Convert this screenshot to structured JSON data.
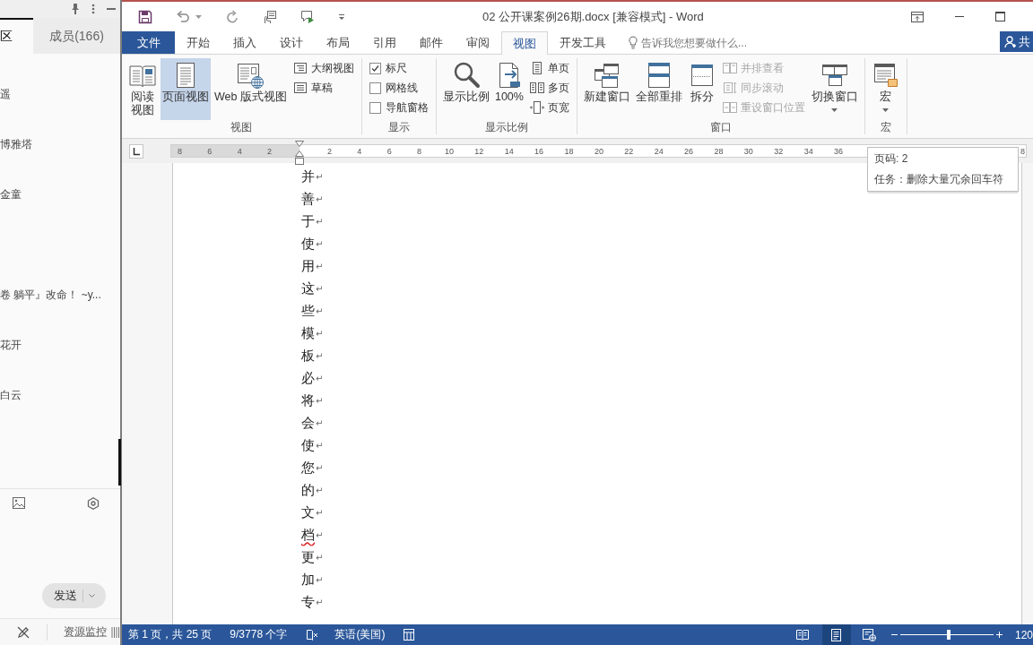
{
  "chat_panel": {
    "tabs": [
      {
        "label": "区",
        "selected": true
      },
      {
        "label": "成员(166)",
        "selected": false
      }
    ],
    "members": [
      {
        "name": "遥"
      },
      {
        "name": "博雅塔"
      },
      {
        "name": "金童"
      },
      {
        "name": "卷 躺平』改命！ ~y..."
      },
      {
        "name": "花开"
      },
      {
        "name": "白云"
      }
    ],
    "send_button": "发送",
    "resource_monitor": "资源监控"
  },
  "word": {
    "title": "02 公开课案例26期.docx [兼容模式] - Word",
    "tabs": [
      {
        "label": "文件",
        "kind": "file",
        "selected": false
      },
      {
        "label": "开始",
        "kind": "tab",
        "selected": false
      },
      {
        "label": "插入",
        "kind": "tab",
        "selected": false
      },
      {
        "label": "设计",
        "kind": "tab",
        "selected": false
      },
      {
        "label": "布局",
        "kind": "tab",
        "selected": false
      },
      {
        "label": "引用",
        "kind": "tab",
        "selected": false
      },
      {
        "label": "邮件",
        "kind": "tab",
        "selected": false
      },
      {
        "label": "审阅",
        "kind": "tab",
        "selected": false
      },
      {
        "label": "视图",
        "kind": "tab",
        "selected": true
      },
      {
        "label": "开发工具",
        "kind": "tab",
        "selected": false
      }
    ],
    "tell_me": {
      "placeholder": "告诉我您想要做什么..."
    },
    "share_button": "共",
    "ribbon_groups": [
      {
        "label": "视图",
        "items": [
          {
            "kind": "large",
            "label": "阅读视图",
            "selected": false
          },
          {
            "kind": "large",
            "label": "页面视图",
            "selected": true
          },
          {
            "kind": "large",
            "label": "Web 版式视图",
            "selected": false
          },
          {
            "kind": "stack",
            "items": [
              {
                "label": "大纲视图",
                "disabled": false
              },
              {
                "label": "草稿",
                "disabled": false
              }
            ]
          }
        ]
      },
      {
        "label": "显示",
        "items": [
          {
            "kind": "checks",
            "items": [
              {
                "label": "标尺",
                "checked": true
              },
              {
                "label": "网格线",
                "checked": false
              },
              {
                "label": "导航窗格",
                "checked": false
              }
            ]
          }
        ]
      },
      {
        "label": "显示比例",
        "items": [
          {
            "kind": "large",
            "label": "显示比例"
          },
          {
            "kind": "large",
            "label": "100%"
          },
          {
            "kind": "stack",
            "items": [
              {
                "label": "单页",
                "disabled": false
              },
              {
                "label": "多页",
                "disabled": false
              },
              {
                "label": "页宽",
                "disabled": false
              }
            ]
          }
        ]
      },
      {
        "label": "窗口",
        "items": [
          {
            "kind": "large",
            "label": "新建窗口"
          },
          {
            "kind": "large",
            "label": "全部重排"
          },
          {
            "kind": "large",
            "label": "拆分"
          },
          {
            "kind": "stack",
            "items": [
              {
                "label": "并排查看",
                "disabled": true
              },
              {
                "label": "同步滚动",
                "disabled": true
              },
              {
                "label": "重设窗口位置",
                "disabled": true
              }
            ]
          },
          {
            "kind": "menu",
            "label": "切换窗口"
          }
        ]
      },
      {
        "label": "宏",
        "items": [
          {
            "kind": "menu",
            "label": "宏"
          }
        ]
      }
    ],
    "ruler": {
      "left_marks": [
        "8",
        "6",
        "4",
        "2"
      ],
      "right_marks": [
        "2",
        "4",
        "6",
        "8",
        "10",
        "12",
        "14",
        "16",
        "18",
        "20",
        "22",
        "24",
        "26",
        "28",
        "30",
        "32",
        "34",
        "36"
      ],
      "end_mark": "8"
    },
    "tooltip": {
      "lines": [
        "页码: 2",
        "任务：删除大量冗余回车符"
      ]
    },
    "paragraphs": [
      {
        "text": "并",
        "mark": "↵",
        "spelling_error": false
      },
      {
        "text": "善",
        "mark": "↵",
        "spelling_error": false
      },
      {
        "text": "于",
        "mark": "↵",
        "spelling_error": false
      },
      {
        "text": "使",
        "mark": "↵",
        "spelling_error": false
      },
      {
        "text": "用",
        "mark": "↵",
        "spelling_error": false
      },
      {
        "text": "这",
        "mark": "↵",
        "spelling_error": false
      },
      {
        "text": "些",
        "mark": "↵",
        "spelling_error": false
      },
      {
        "text": "模",
        "mark": "↵",
        "spelling_error": false
      },
      {
        "text": "板",
        "mark": "↵",
        "spelling_error": false
      },
      {
        "text": "必",
        "mark": "↵",
        "spelling_error": false
      },
      {
        "text": "将",
        "mark": "↵",
        "spelling_error": false
      },
      {
        "text": "会",
        "mark": "↵",
        "spelling_error": false
      },
      {
        "text": "使",
        "mark": "↵",
        "spelling_error": false
      },
      {
        "text": "您",
        "mark": "↵",
        "spelling_error": false
      },
      {
        "text": "的",
        "mark": "↵",
        "spelling_error": false
      },
      {
        "text": "文",
        "mark": "↵",
        "spelling_error": false
      },
      {
        "text": "档",
        "mark": "↵",
        "spelling_error": true
      },
      {
        "text": "更",
        "mark": "↵",
        "spelling_error": false
      },
      {
        "text": "加",
        "mark": "↵",
        "spelling_error": false
      },
      {
        "text": "专",
        "mark": "↵",
        "spelling_error": false
      }
    ],
    "status_bar": {
      "page": "第 1 页，共 25 页",
      "words": "9/3778 个字",
      "language": "英语(美国)",
      "views": [
        {
          "selected": false
        },
        {
          "selected": true
        },
        {
          "selected": false
        }
      ],
      "zoom": {
        "level": 0.52,
        "reading": "120"
      }
    }
  }
}
